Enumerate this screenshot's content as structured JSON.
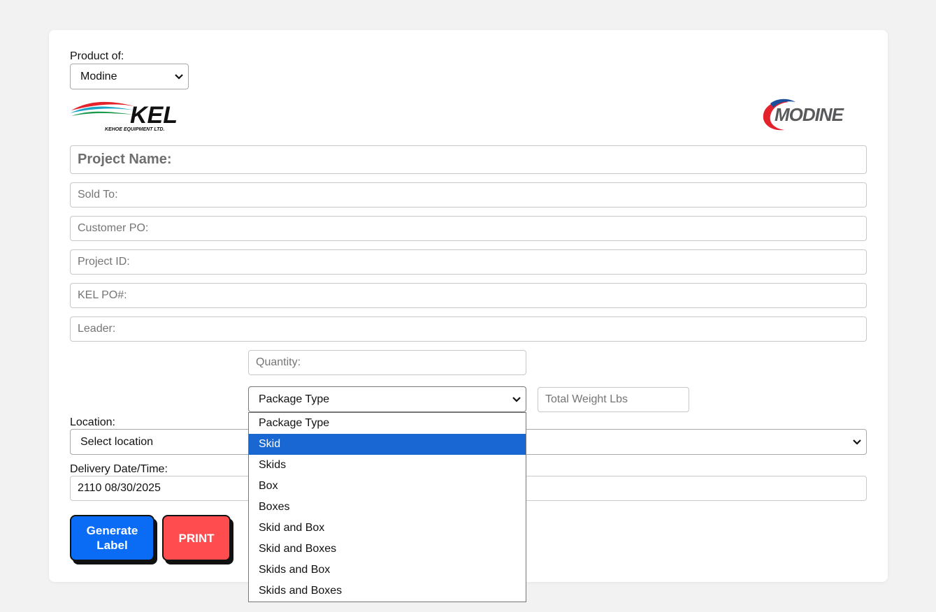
{
  "product_of": {
    "label": "Product of:",
    "selected": "Modine"
  },
  "logos": {
    "kel": {
      "text": "KEL",
      "subtitle": "KEHOE EQUIPMENT LTD."
    },
    "modine": {
      "text": "MODINE"
    }
  },
  "fields": {
    "project_name": {
      "placeholder": "Project Name:"
    },
    "sold_to": {
      "placeholder": "Sold To:"
    },
    "customer_po": {
      "placeholder": "Customer PO:"
    },
    "project_id": {
      "placeholder": "Project ID:"
    },
    "kel_po": {
      "placeholder": "KEL PO#:"
    },
    "leader": {
      "placeholder": "Leader:"
    },
    "quantity": {
      "placeholder": "Quantity:"
    },
    "total_weight": {
      "placeholder": "Total Weight Lbs"
    }
  },
  "package_type": {
    "selected": "Package Type",
    "options": [
      "Package Type",
      "Skid",
      "Skids",
      "Box",
      "Boxes",
      "Skid and Box",
      "Skid and Boxes",
      "Skids and Box",
      "Skids and Boxes"
    ],
    "highlighted": "Skid"
  },
  "location": {
    "label": "Location:",
    "selected": "Select location"
  },
  "delivery": {
    "label": "Delivery Date/Time:",
    "value": "2110 08/30/2025"
  },
  "buttons": {
    "generate": "Generate Label",
    "print": "PRINT"
  },
  "colors": {
    "generate_bg": "#0a6cf5",
    "print_bg": "#ff4d4f",
    "highlight": "#1967d2",
    "modine_red": "#e4222b",
    "modine_blue": "#1b4f9c"
  },
  "icons": [
    "chevron-down-icon"
  ]
}
